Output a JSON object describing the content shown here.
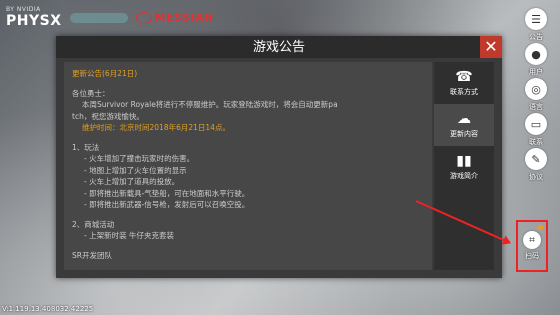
{
  "brand": {
    "physx": "PHYSX",
    "physx_sub": "BY NVIDIA",
    "messiah": "MESSIAH"
  },
  "version": "V:1.119.13.408032.42225",
  "dialog": {
    "title": "游戏公告",
    "close": "✕",
    "content": {
      "update_header": "更新公告(6月21日)",
      "greeting": "各位勇士：",
      "intro_1": "本周Survivor Royale将进行不停服维护。玩家登陆游戏时，将会自动更新pa",
      "intro_2": "tch，祝您游戏愉快。",
      "maintenance": "维护时间：北京时间2018年6月21日14点。",
      "sec1_title": "1、玩法",
      "sec1_items": [
        "- 火车增加了撞击玩家时的伤害。",
        "- 地图上增加了火车位置的显示",
        "- 火车上增加了道具的投放。",
        "- 即将推出新载具-气垫船，可在地面和水平行驶。",
        "- 即将推出新武器-信号枪，发射后可以召唤空投。"
      ],
      "sec2_title": "2、商城活动",
      "sec2_items": [
        "- 上架新时装 牛仔夹克套装"
      ],
      "signature": "SR开发团队"
    },
    "tabs": [
      {
        "label": "联系方式",
        "icon": "phone-book-icon",
        "glyph": "☎"
      },
      {
        "label": "更新内容",
        "icon": "cloud-download-icon",
        "glyph": "☁"
      },
      {
        "label": "游戏简介",
        "icon": "book-icon",
        "glyph": "▮▮"
      }
    ]
  },
  "rail": [
    {
      "label": "公告",
      "icon": "notice-icon",
      "glyph": "☰"
    },
    {
      "label": "用户",
      "icon": "user-icon",
      "glyph": "●"
    },
    {
      "label": "语言",
      "icon": "globe-icon",
      "glyph": "◎"
    },
    {
      "label": "联系",
      "icon": "monitor-icon",
      "glyph": "▭"
    },
    {
      "label": "协议",
      "icon": "pen-icon",
      "glyph": "✎"
    }
  ],
  "scan": {
    "label": "扫码",
    "icon": "scan-icon",
    "glyph": "⌗"
  }
}
